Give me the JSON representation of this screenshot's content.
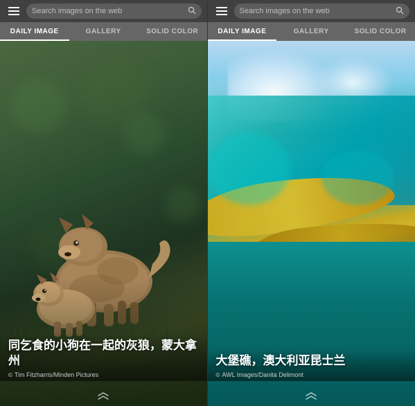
{
  "left": {
    "search_placeholder": "Search images on the web",
    "tabs": [
      {
        "label": "DAILY IMAGE",
        "active": true
      },
      {
        "label": "GALLERY",
        "active": false
      },
      {
        "label": "SOLID COLOR",
        "active": false
      }
    ],
    "caption_title": "同乞食的小狗在一起的灰狼，蒙大拿州",
    "caption_credit": "Tim Fitzharris/Minden Pictures",
    "arrow": "⌃⌃"
  },
  "right": {
    "search_placeholder": "Search images on the web",
    "tabs": [
      {
        "label": "DAILY IMAGE",
        "active": true
      },
      {
        "label": "GALLERY",
        "active": false
      },
      {
        "label": "SOLID COLOR",
        "active": false
      }
    ],
    "caption_title": "大堡礁，澳大利亚昆士兰",
    "caption_credit": "AWL Images/Danita Delimont",
    "arrow": "⌃⌃"
  }
}
